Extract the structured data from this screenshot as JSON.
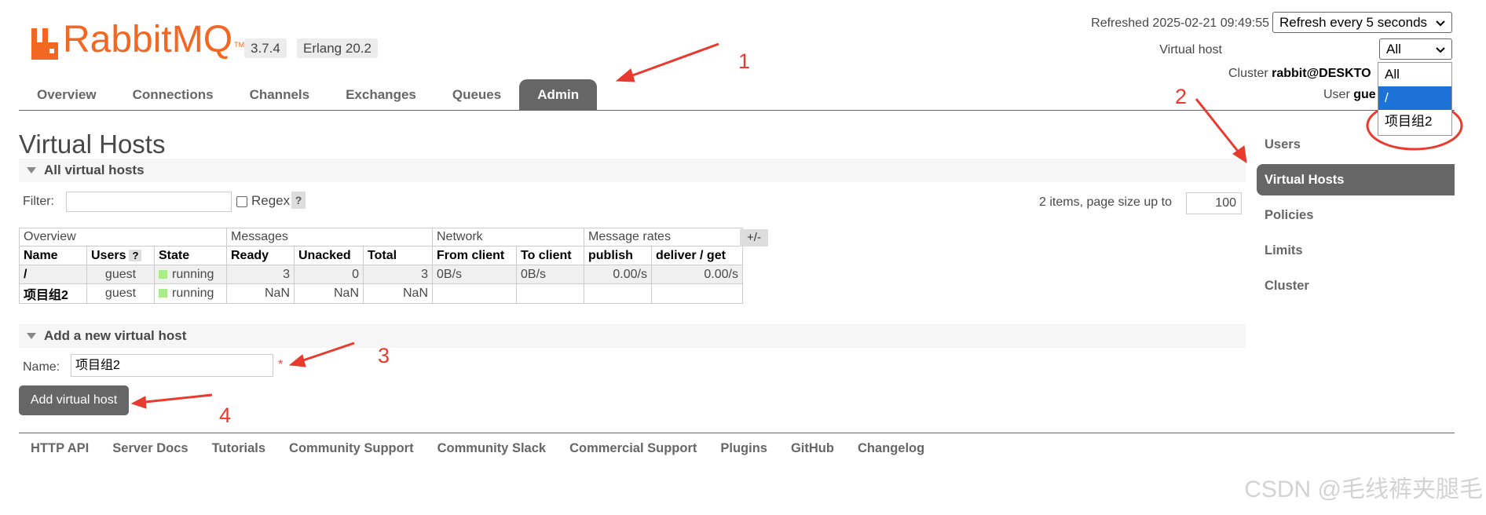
{
  "header": {
    "logo_text": "RabbitMQ",
    "logo_tm": "TM",
    "version": "3.7.4",
    "erlang": "Erlang 20.2",
    "refreshed": "Refreshed 2025-02-21 09:49:55",
    "refresh_select": "Refresh every 5 seconds",
    "vhost_label": "Virtual host",
    "vhost_selected": "All",
    "cluster_label": "Cluster ",
    "cluster_value": "rabbit@DESKTO",
    "user_label": "User ",
    "user_value": "gue"
  },
  "vhost_dropdown": [
    "All",
    "/",
    "项目组2"
  ],
  "tabs": [
    "Overview",
    "Connections",
    "Channels",
    "Exchanges",
    "Queues",
    "Admin"
  ],
  "page": {
    "title": "Virtual Hosts",
    "all_section": "All virtual hosts",
    "filter_label": "Filter:",
    "filter_value": "",
    "regex_label": "Regex",
    "help": "?",
    "items_text": "2 items, page size up to",
    "page_size": "100",
    "plus_minus": "+/-"
  },
  "table": {
    "groups": [
      "Overview",
      "Messages",
      "Network",
      "Message rates"
    ],
    "columns": [
      "Name",
      "Users",
      "State",
      "Ready",
      "Unacked",
      "Total",
      "From client",
      "To client",
      "publish",
      "deliver / get"
    ],
    "rows": [
      {
        "name": "/",
        "users": "guest",
        "state": "running",
        "ready": "3",
        "unacked": "0",
        "total": "3",
        "from_client": "0B/s",
        "to_client": "0B/s",
        "publish": "0.00/s",
        "deliver_get": "0.00/s"
      },
      {
        "name": "项目组2",
        "users": "guest",
        "state": "running",
        "ready": "NaN",
        "unacked": "NaN",
        "total": "NaN",
        "from_client": "",
        "to_client": "",
        "publish": "",
        "deliver_get": ""
      }
    ]
  },
  "add_section": {
    "title": "Add a new virtual host",
    "name_label": "Name:",
    "name_value": "项目组2",
    "asterisk": "*",
    "button": "Add virtual host"
  },
  "footer": [
    "HTTP API",
    "Server Docs",
    "Tutorials",
    "Community Support",
    "Community Slack",
    "Commercial Support",
    "Plugins",
    "GitHub",
    "Changelog"
  ],
  "sidemenu": [
    "Users",
    "Virtual Hosts",
    "Policies",
    "Limits",
    "Cluster"
  ],
  "annotations": [
    "1",
    "2",
    "3",
    "4"
  ],
  "watermark": "CSDN @毛线裤夹腿毛",
  "colors": {
    "brand": "#f26822",
    "annotation": "#e83a2e",
    "dark": "#666666",
    "selected": "#1d72d8",
    "running": "#aaeb8a"
  }
}
